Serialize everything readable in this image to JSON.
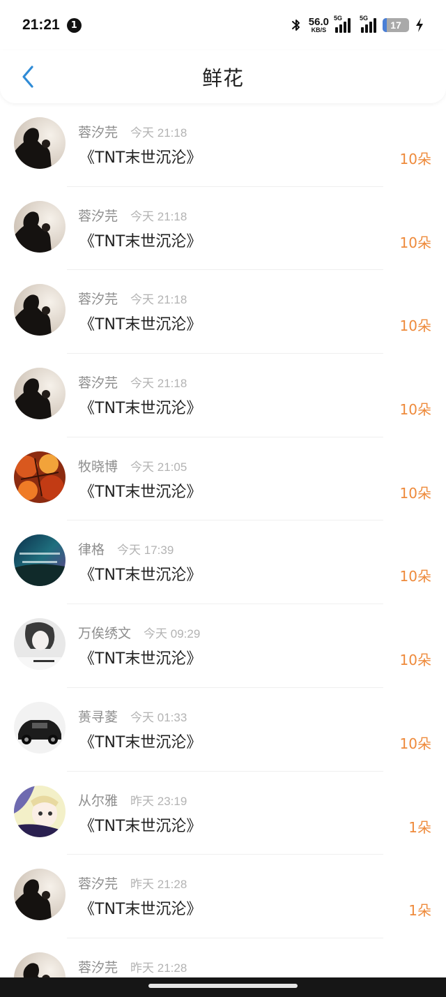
{
  "status_bar": {
    "time": "21:21",
    "notification_count": "1",
    "net_speed_value": "56.0",
    "net_speed_unit": "KB/S",
    "sim1_label": "5G",
    "sim2_label": "5G",
    "battery_level": "17",
    "battery_fill_percent": 17
  },
  "header": {
    "title": "鲜花"
  },
  "colors": {
    "accent_blue": "#2f8bd6",
    "count_orange": "#ee8a3b"
  },
  "items": [
    {
      "user": "蓉汐芫",
      "time": "今天 21:18",
      "book": "《TNT末世沉沦》",
      "count": "10朵",
      "avatar": "silhouette-avatar"
    },
    {
      "user": "蓉汐芫",
      "time": "今天 21:18",
      "book": "《TNT末世沉沦》",
      "count": "10朵",
      "avatar": "silhouette-avatar"
    },
    {
      "user": "蓉汐芫",
      "time": "今天 21:18",
      "book": "《TNT末世沉沦》",
      "count": "10朵",
      "avatar": "silhouette-avatar"
    },
    {
      "user": "蓉汐芫",
      "time": "今天 21:18",
      "book": "《TNT末世沉沦》",
      "count": "10朵",
      "avatar": "silhouette-avatar"
    },
    {
      "user": "牧晓博",
      "time": "今天 21:05",
      "book": "《TNT末世沉沦》",
      "count": "10朵",
      "avatar": "autumn-leaves-avatar"
    },
    {
      "user": "律格",
      "time": "今天 17:39",
      "book": "《TNT末世沉沦》",
      "count": "10朵",
      "avatar": "night-sky-avatar"
    },
    {
      "user": "万俟绣文",
      "time": "今天 09:29",
      "book": "《TNT末世沉沦》",
      "count": "10朵",
      "avatar": "girl-photo-avatar"
    },
    {
      "user": "蒉寻菱",
      "time": "今天 01:33",
      "book": "《TNT末世沉沦》",
      "count": "10朵",
      "avatar": "black-car-avatar"
    },
    {
      "user": "从尔雅",
      "time": "昨天 23:19",
      "book": "《TNT末世沉沦》",
      "count": "1朵",
      "avatar": "anime-girl-avatar"
    },
    {
      "user": "蓉汐芫",
      "time": "昨天 21:28",
      "book": "《TNT末世沉沦》",
      "count": "1朵",
      "avatar": "silhouette-avatar"
    },
    {
      "user": "蓉汐芫",
      "time": "昨天 21:28",
      "book": "",
      "count": "",
      "avatar": "silhouette-avatar"
    }
  ]
}
